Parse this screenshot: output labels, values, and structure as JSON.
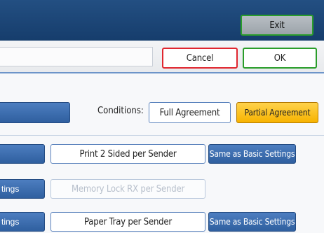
{
  "header": {
    "exit_label": "Exit"
  },
  "toolbar": {
    "cancel_label": "Cancel",
    "ok_label": "OK"
  },
  "conditions": {
    "label": "Conditions:",
    "options": [
      {
        "label": "Full Agreement",
        "selected": false
      },
      {
        "label": "Partial Agreement",
        "selected": true
      }
    ]
  },
  "rows": [
    {
      "left_label": "",
      "option_label": "Print 2 Sided per Sender",
      "option_enabled": true,
      "setting_label": "Same as Basic Settings"
    },
    {
      "left_label": "tings",
      "option_label": "Memory Lock RX per Sender",
      "option_enabled": false,
      "setting_label": ""
    },
    {
      "left_label": "tings",
      "option_label": "Paper Tray per Sender",
      "option_enabled": true,
      "setting_label": "Same as Basic Settings"
    }
  ],
  "colors": {
    "header_bg": "#1b4576",
    "accent_blue": "#2f5f9f",
    "selected_orange": "#f7b300",
    "cancel_border": "#e0262f",
    "ok_border": "#2a9d2a"
  }
}
